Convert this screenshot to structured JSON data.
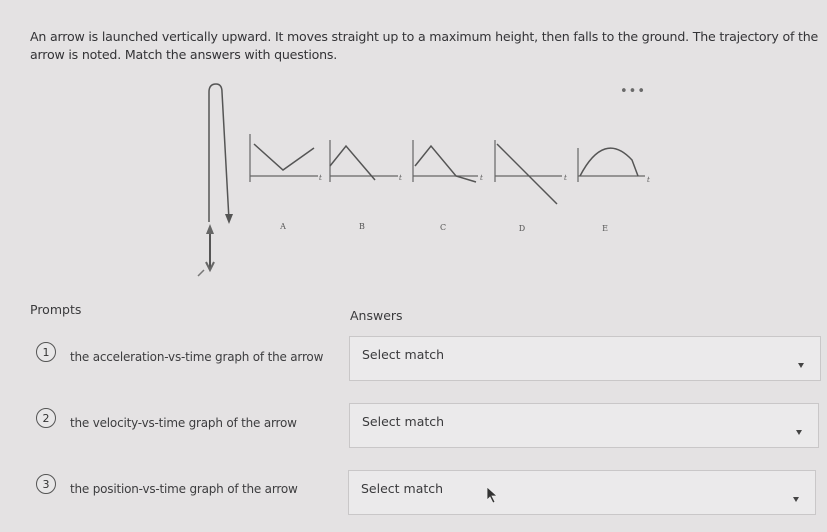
{
  "question": "An arrow is launched vertically upward. It moves straight up to a maximum height, then falls to the ground. The trajectory of the arrow is noted. Match the answers with questions.",
  "more_icon": "•••",
  "graphs": [
    {
      "letter": "A",
      "axis_label": "t"
    },
    {
      "letter": "B",
      "axis_label": "t"
    },
    {
      "letter": "C",
      "axis_label": "t"
    },
    {
      "letter": "D",
      "axis_label": "t"
    },
    {
      "letter": "E",
      "axis_label": "t"
    }
  ],
  "prompts_header": "Prompts",
  "answers_header": "Answers",
  "prompts": [
    {
      "number": "1",
      "text": "the acceleration-vs-time graph of the arrow"
    },
    {
      "number": "2",
      "text": "the velocity-vs-time graph of the arrow"
    },
    {
      "number": "3",
      "text": "the position-vs-time graph of the arrow"
    }
  ],
  "answers": [
    {
      "placeholder": "Select match"
    },
    {
      "placeholder": "Select match"
    },
    {
      "placeholder": "Select match"
    }
  ]
}
